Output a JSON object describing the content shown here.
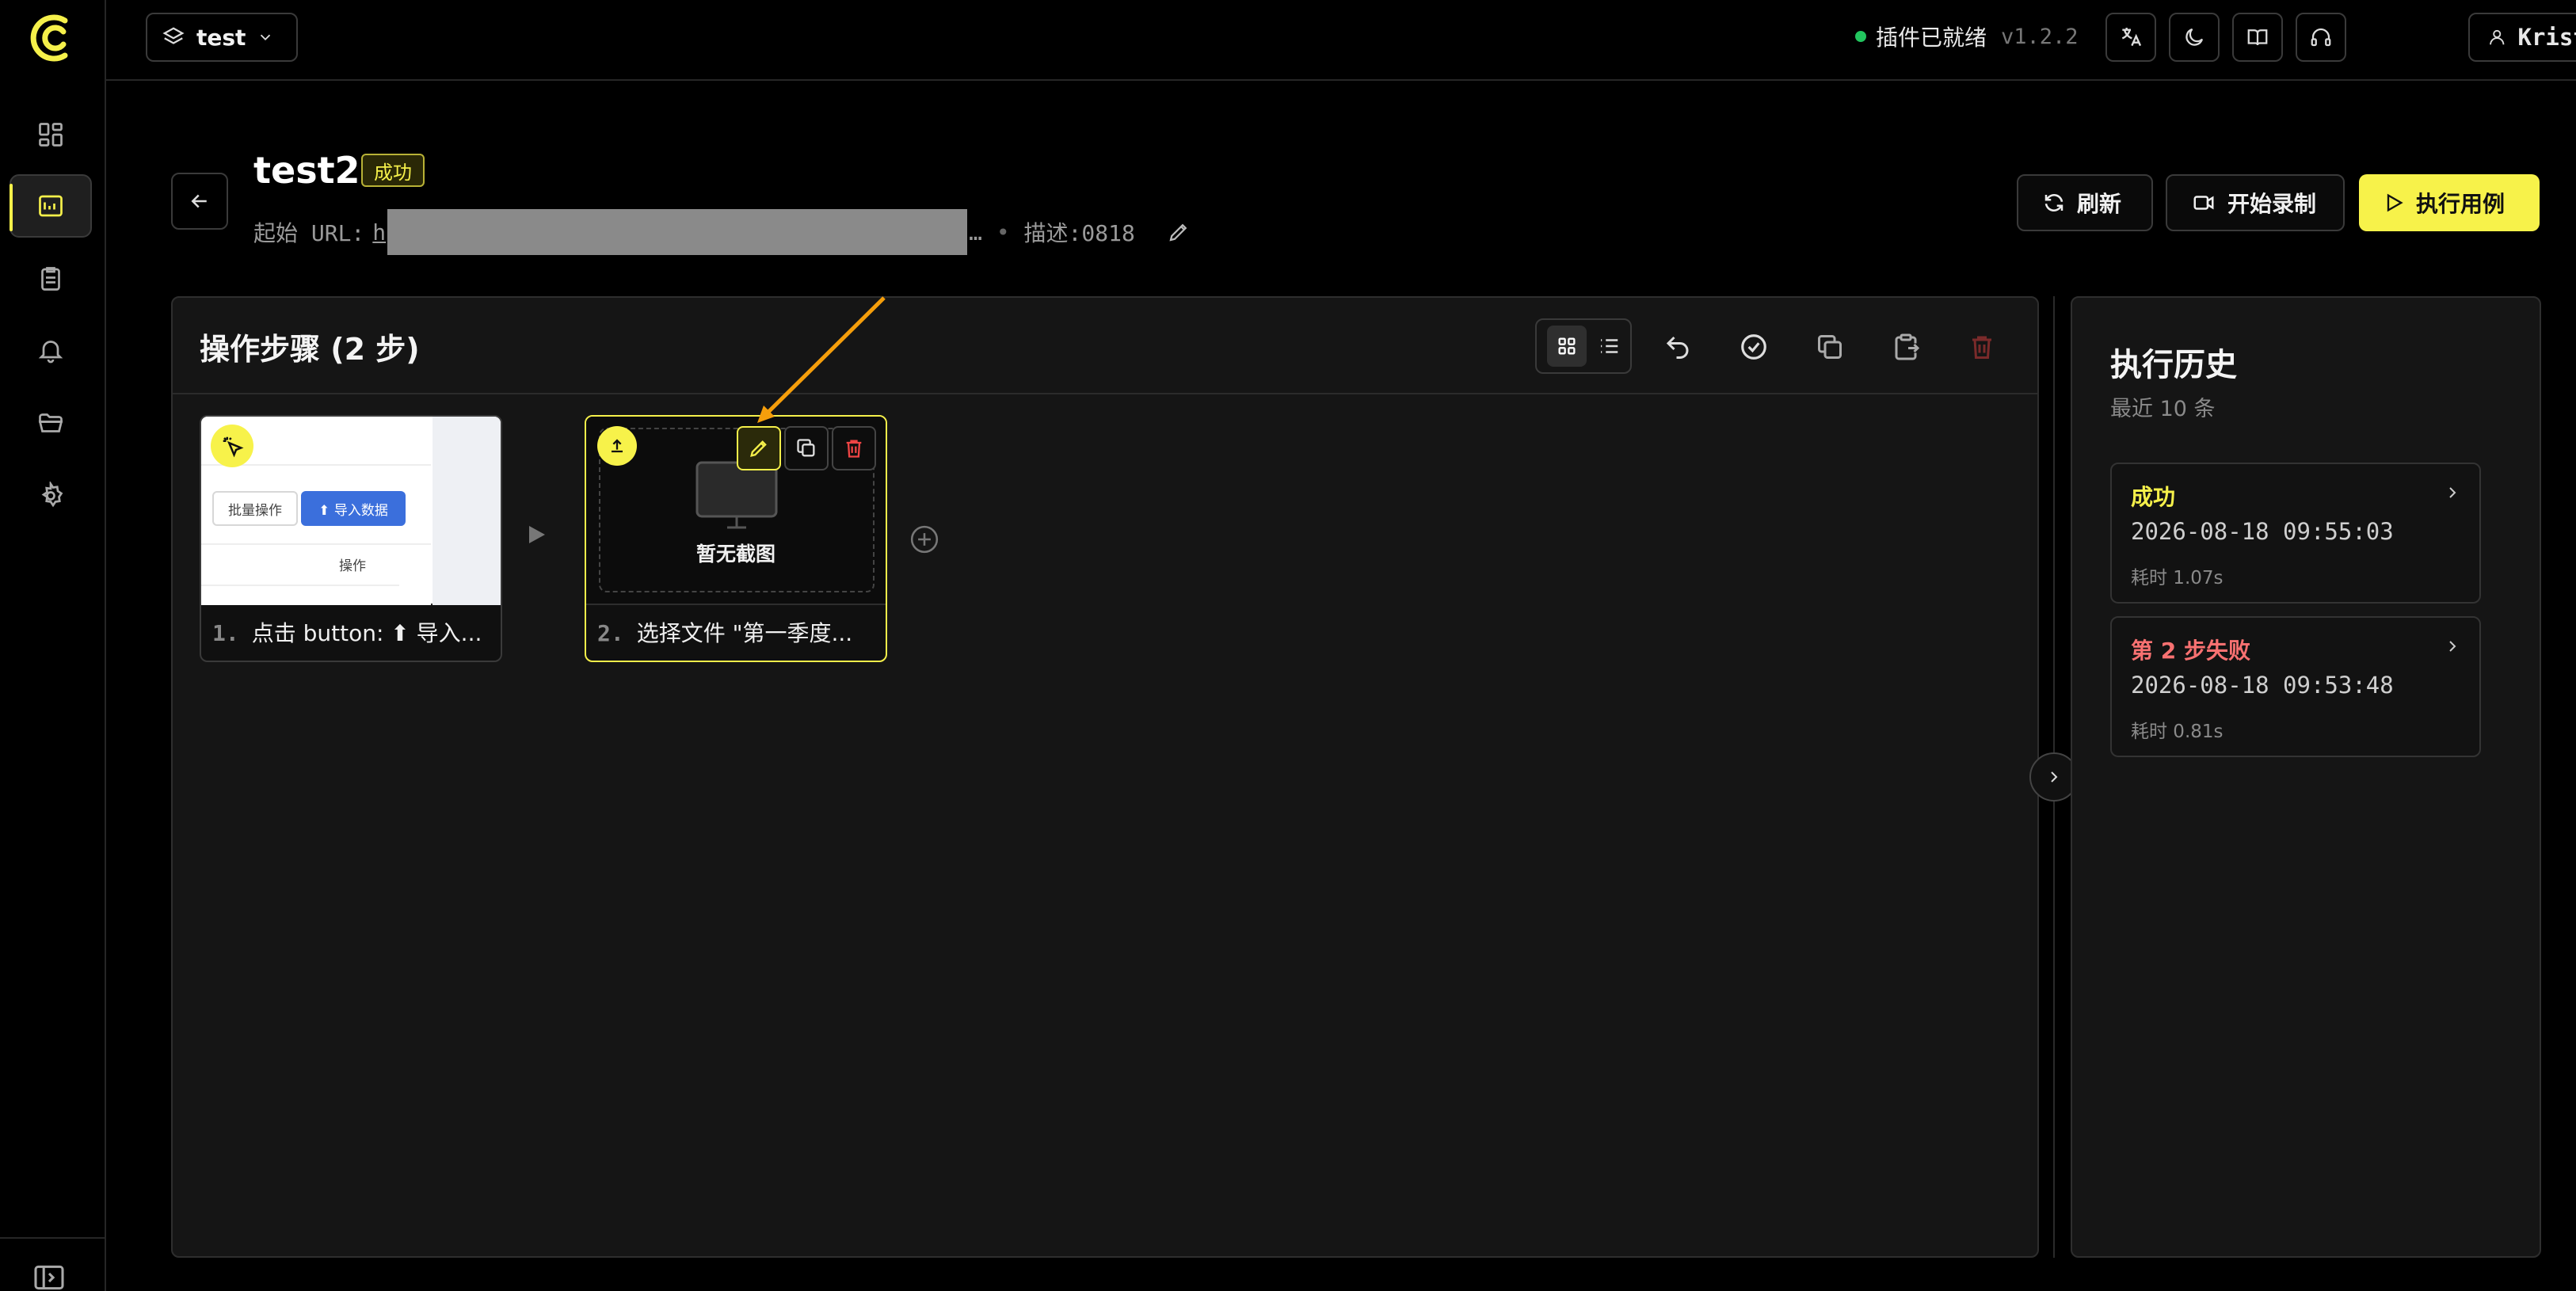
{
  "topbar": {
    "project": "test",
    "status_text": "插件已就绪",
    "version": "v1.2.2",
    "user_name": "Kristen"
  },
  "case": {
    "title": "test2",
    "badge": "成功",
    "url_label": "起始 URL:",
    "url_visible": "h",
    "url_suffix": "…",
    "desc": "描述:0818"
  },
  "actions": {
    "refresh": "刷新",
    "record": "开始录制",
    "run": "执行用例"
  },
  "steps": {
    "title": "操作步骤 (2 步)",
    "items": [
      {
        "num": "1.",
        "label": "点击 button: ⬆ 导入..."
      },
      {
        "num": "2.",
        "label": "选择文件 \"第一季度..."
      }
    ],
    "thumb1": {
      "batch_btn": "批量操作",
      "import_btn": "⬆ 导入数据",
      "col": "操作"
    },
    "no_screenshot": "暂无截图"
  },
  "history": {
    "title": "执行历史",
    "subtitle": "最近 10 条",
    "items": [
      {
        "status": "成功",
        "time": "2026-08-18 09:55:03",
        "duration": "耗时 1.07s"
      },
      {
        "status": "第 2 步失败",
        "time": "2026-08-18 09:53:48",
        "duration": "耗时 0.81s"
      }
    ]
  },
  "colors": {
    "accent": "#f7f24a",
    "success": "#f5f04a",
    "fail": "#f87171",
    "ready": "#22c55e"
  }
}
